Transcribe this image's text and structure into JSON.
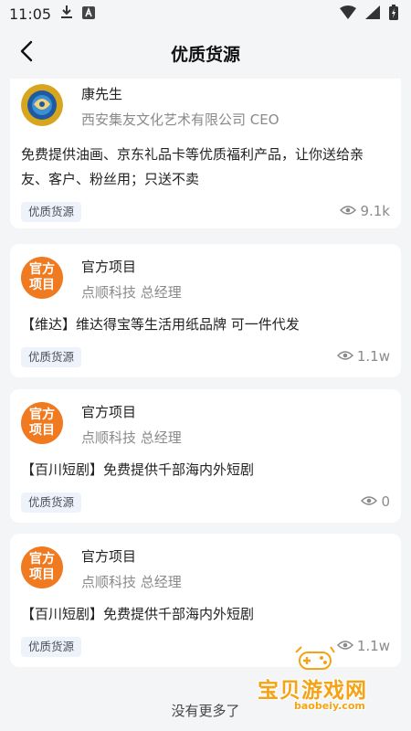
{
  "status_bar": {
    "time": "11:05"
  },
  "header": {
    "back_icon": "chevron-left-icon",
    "title": "优质货源"
  },
  "cards": [
    {
      "name": "康先生",
      "role": "西安集友文化艺术有限公司 CEO",
      "desc": "免费提供油画、京东礼品卡等优质福利产品，让你送给亲友、客户、粉丝用；只送不卖",
      "tag": "优质货源",
      "views": "9.1k"
    },
    {
      "badge": [
        "官方",
        "项目"
      ],
      "name": "官方项目",
      "role": "点顺科技 总经理",
      "desc": "【维达】维达得宝等生活用纸品牌 可一件代发",
      "tag": "优质货源",
      "views": "1.1w"
    },
    {
      "badge": [
        "官方",
        "项目"
      ],
      "name": "官方项目",
      "role": "点顺科技 总经理",
      "desc": "【百川短剧】免费提供千部海内外短剧",
      "tag": "优质货源",
      "views": "0"
    },
    {
      "badge": [
        "官方",
        "项目"
      ],
      "name": "官方项目",
      "role": "点顺科技 总经理",
      "desc": "【百川短剧】免费提供千部海内外短剧",
      "tag": "优质货源",
      "views": "1.1w"
    }
  ],
  "footer": {
    "text": "没有更多了"
  },
  "watermark": {
    "title": "宝贝游戏网",
    "url": "baobeiy.com"
  },
  "colors": {
    "badge": "#ef7a1f",
    "tag_bg": "#eef3fb",
    "watermark": "#f5a314"
  }
}
